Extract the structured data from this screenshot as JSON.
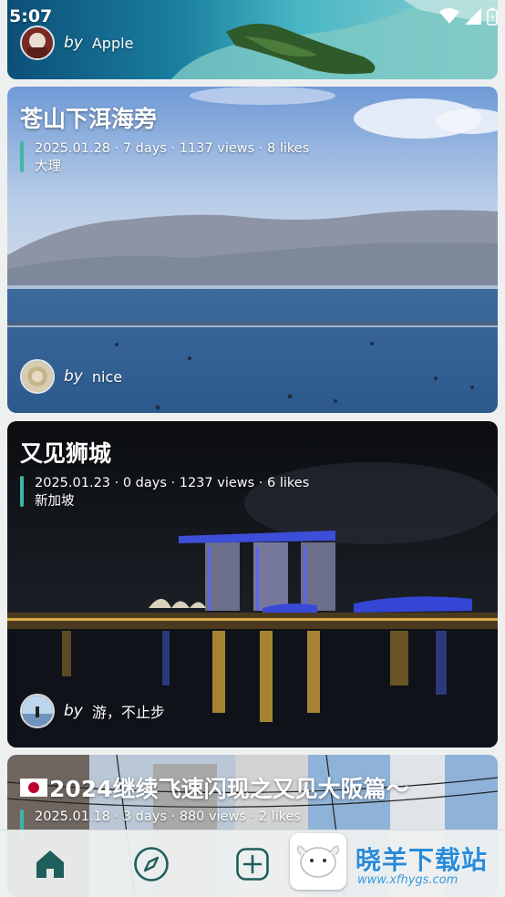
{
  "status_bar": {
    "time": "5:07"
  },
  "cards": [
    {
      "author_by": "by",
      "author_name": "Apple"
    },
    {
      "title": "苍山下洱海旁",
      "meta": "2025.01.28 · 7 days · 1137 views · 8 likes",
      "location": "大理",
      "author_by": "by",
      "author_name": "nice"
    },
    {
      "title": "又见狮城",
      "meta": "2025.01.23 · 0 days · 1237 views · 6 likes",
      "location": "新加坡",
      "author_by": "by",
      "author_name": "游，不止步"
    },
    {
      "title": "2024继续飞速闪现之又见大阪篇～",
      "meta": "2025.01.18 · 3 days · 880 views · 2 likes"
    }
  ],
  "tab_bar": {
    "tabs": [
      {
        "icon": "home-icon"
      },
      {
        "icon": "compass-icon"
      },
      {
        "icon": "add-icon"
      }
    ]
  },
  "watermark": {
    "text": "晓羊下载站",
    "url": "www.xfhygs.com"
  },
  "colors": {
    "accent": "#1f5f5b",
    "meta_bar": "#3fb6a8"
  }
}
